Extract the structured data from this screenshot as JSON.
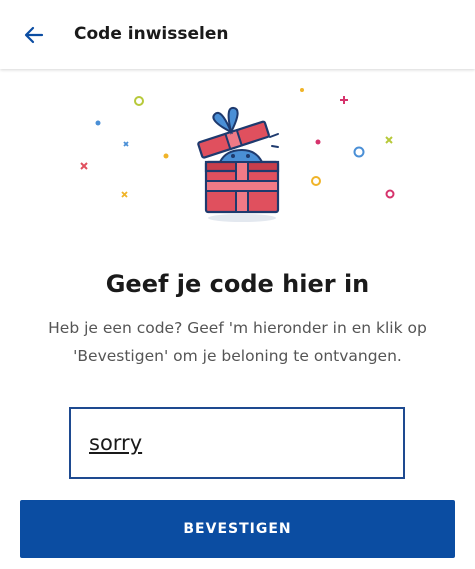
{
  "header": {
    "back_icon": "arrow-left-icon",
    "title": "Code inwisselen"
  },
  "main": {
    "illustration": "gift-box-icon",
    "heading": "Geef je code hier in",
    "description": "Heb je een code? Geef 'm hieronder in en klik op 'Bevestigen' om je beloning te ontvangen.",
    "code_input": {
      "value": "sorry"
    },
    "confirm_label": "BEVESTIGEN"
  },
  "colors": {
    "primary": "#0b4da2",
    "input_border": "#1e4a90",
    "gift_red": "#e0505e",
    "gift_blue": "#4a8fd6"
  }
}
